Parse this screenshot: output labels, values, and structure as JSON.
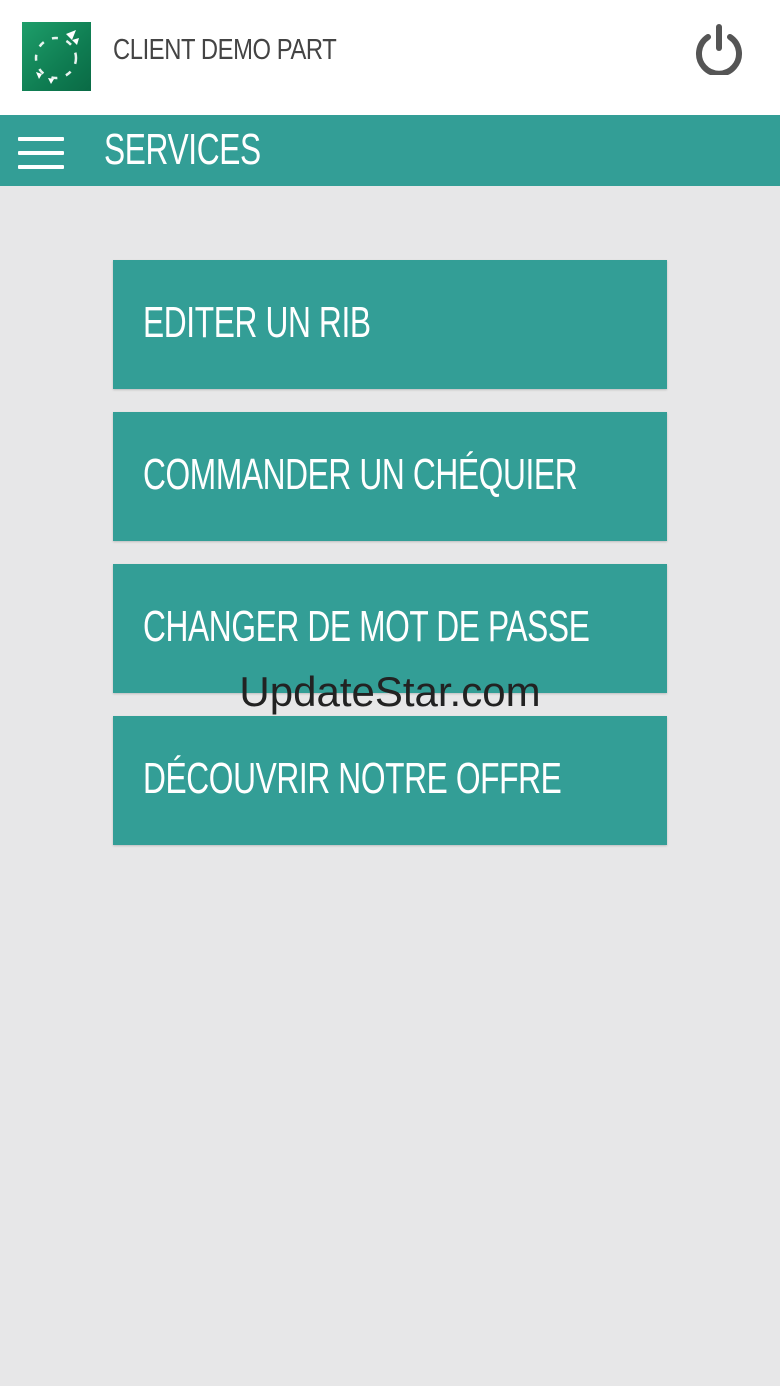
{
  "header": {
    "client_name": "CLIENT DEMO PART",
    "logo_icon": "bank-logo-icon",
    "power_icon": "power-icon"
  },
  "navbar": {
    "title": "SERVICES",
    "menu_icon": "hamburger-menu-icon"
  },
  "services": [
    {
      "label": "EDITER UN RIB"
    },
    {
      "label": "COMMANDER UN CHÉQUIER"
    },
    {
      "label": "CHANGER DE MOT DE PASSE"
    },
    {
      "label": "DÉCOUVRIR NOTRE OFFRE"
    }
  ],
  "watermark": "UpdateStar.com",
  "colors": {
    "accent": "#339e96",
    "background": "#e7e7e8",
    "header_bg": "#ffffff",
    "logo_green": "#0f7d52",
    "text_dark": "#444444"
  }
}
